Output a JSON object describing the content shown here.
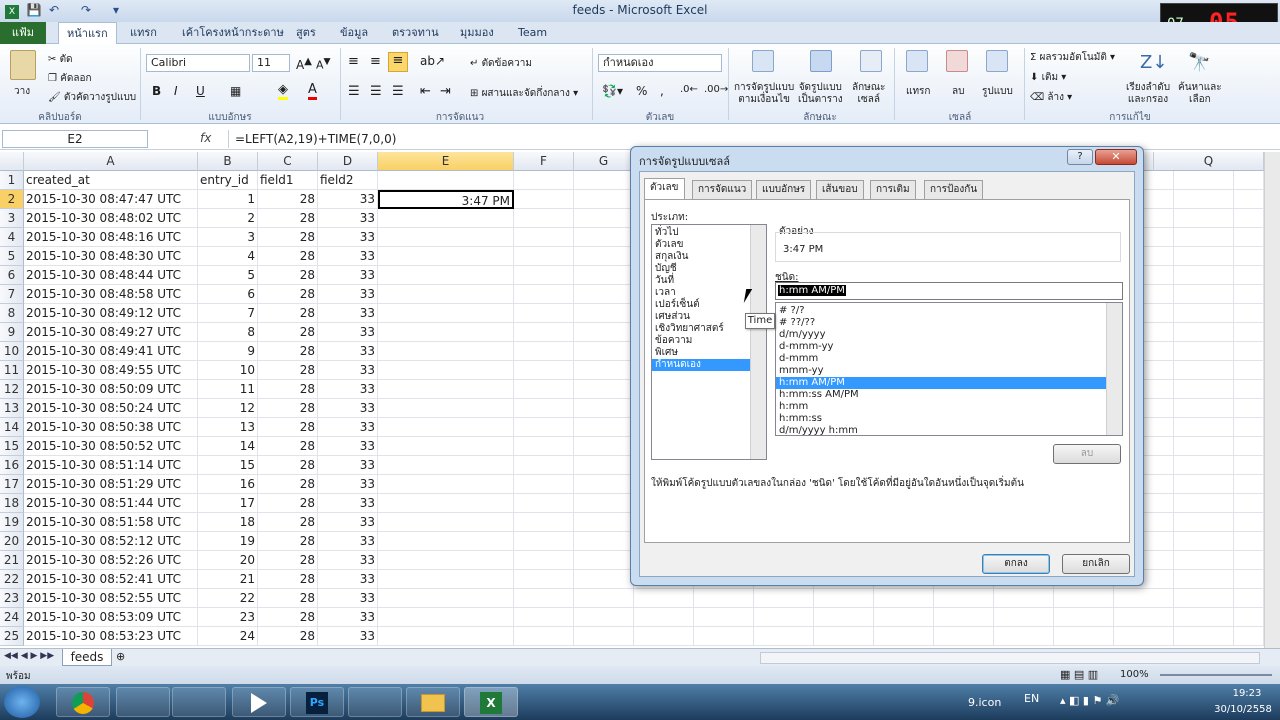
{
  "window": {
    "title": "feeds - Microsoft Excel"
  },
  "clock_overlay": {
    "small": "07",
    "big": "05"
  },
  "ribbon_tabs": [
    "แฟ้ม",
    "หน้าแรก",
    "แทรก",
    "เค้าโครงหน้ากระดาษ",
    "สูตร",
    "ข้อมูล",
    "ตรวจทาน",
    "มุมมอง",
    "Team"
  ],
  "ribbon": {
    "paste": "วาง",
    "cut": "ตัด",
    "copy": "คัดลอก",
    "format_painter": "ตัวคัดวางรูปแบบ",
    "clipboard": "คลิปบอร์ด",
    "font_name": "Calibri",
    "font_size": "11",
    "font_group": "แบบอักษร",
    "wrap": "ตัดข้อความ",
    "merge": "ผสานและจัดกึ่งกลาง",
    "alignment": "การจัดแนว",
    "number_format": "กำหนดเอง",
    "number": "ตัวเลข",
    "cond_format": "การจัดรูปแบบ\nตามเงื่อนไข",
    "format_table": "จัดรูปแบบ\nเป็นตาราง",
    "cell_styles": "ลักษณะ\nเซลล์",
    "styles": "ลักษณะ",
    "insert": "แทรก",
    "delete": "ลบ",
    "format": "รูปแบบ",
    "cells": "เซลล์",
    "autosum": "ผลรวมอัตโนมัติ",
    "fill": "เติม",
    "clear": "ล้าง",
    "sort": "เรียงลำดับ\nและกรอง",
    "find": "ค้นหาและ\nเลือก",
    "editing": "การแก้ไข"
  },
  "formula_bar": {
    "cell_ref": "E2",
    "fx": "fx",
    "formula": "=LEFT(A2,19)+TIME(7,0,0)"
  },
  "columns": [
    "A",
    "B",
    "C",
    "D",
    "E",
    "F",
    "G"
  ],
  "extra_columns": [
    "Q"
  ],
  "rows": [
    [
      "1",
      "created_at",
      "entry_id",
      "field1",
      "field2",
      ""
    ],
    [
      "2",
      "2015-10-30 08:47:47 UTC",
      "1",
      "28",
      "33",
      "3:47 PM"
    ],
    [
      "3",
      "2015-10-30 08:48:02 UTC",
      "2",
      "28",
      "33",
      ""
    ],
    [
      "4",
      "2015-10-30 08:48:16 UTC",
      "3",
      "28",
      "33",
      ""
    ],
    [
      "5",
      "2015-10-30 08:48:30 UTC",
      "4",
      "28",
      "33",
      ""
    ],
    [
      "6",
      "2015-10-30 08:48:44 UTC",
      "5",
      "28",
      "33",
      ""
    ],
    [
      "7",
      "2015-10-30 08:48:58 UTC",
      "6",
      "28",
      "33",
      ""
    ],
    [
      "8",
      "2015-10-30 08:49:12 UTC",
      "7",
      "28",
      "33",
      ""
    ],
    [
      "9",
      "2015-10-30 08:49:27 UTC",
      "8",
      "28",
      "33",
      ""
    ],
    [
      "10",
      "2015-10-30 08:49:41 UTC",
      "9",
      "28",
      "33",
      ""
    ],
    [
      "11",
      "2015-10-30 08:49:55 UTC",
      "10",
      "28",
      "33",
      ""
    ],
    [
      "12",
      "2015-10-30 08:50:09 UTC",
      "11",
      "28",
      "33",
      ""
    ],
    [
      "13",
      "2015-10-30 08:50:24 UTC",
      "12",
      "28",
      "33",
      ""
    ],
    [
      "14",
      "2015-10-30 08:50:38 UTC",
      "13",
      "28",
      "33",
      ""
    ],
    [
      "15",
      "2015-10-30 08:50:52 UTC",
      "14",
      "28",
      "33",
      ""
    ],
    [
      "16",
      "2015-10-30 08:51:14 UTC",
      "15",
      "28",
      "33",
      ""
    ],
    [
      "17",
      "2015-10-30 08:51:29 UTC",
      "16",
      "28",
      "33",
      ""
    ],
    [
      "18",
      "2015-10-30 08:51:44 UTC",
      "17",
      "28",
      "33",
      ""
    ],
    [
      "19",
      "2015-10-30 08:51:58 UTC",
      "18",
      "28",
      "33",
      ""
    ],
    [
      "20",
      "2015-10-30 08:52:12 UTC",
      "19",
      "28",
      "33",
      ""
    ],
    [
      "21",
      "2015-10-30 08:52:26 UTC",
      "20",
      "28",
      "33",
      ""
    ],
    [
      "22",
      "2015-10-30 08:52:41 UTC",
      "21",
      "28",
      "33",
      ""
    ],
    [
      "23",
      "2015-10-30 08:52:55 UTC",
      "22",
      "28",
      "33",
      ""
    ],
    [
      "24",
      "2015-10-30 08:53:09 UTC",
      "23",
      "28",
      "33",
      ""
    ],
    [
      "25",
      "2015-10-30 08:53:23 UTC",
      "24",
      "28",
      "33",
      ""
    ]
  ],
  "sheet_tab": "feeds",
  "status": {
    "ready": "พร้อม",
    "zoom": "100%"
  },
  "taskbar": {
    "lang": "EN",
    "file_label": "9.icon",
    "time": "19:23",
    "date": "30/10/2558"
  },
  "dialog": {
    "title": "การจัดรูปแบบเซลล์",
    "tabs": [
      "ตัวเลข",
      "การจัดแนว",
      "แบบอักษร",
      "เส้นขอบ",
      "การเติม",
      "การป้องกัน"
    ],
    "category_label": "ประเภท:",
    "categories": [
      "ทั่วไป",
      "ตัวเลข",
      "สกุลเงิน",
      "บัญชี",
      "วันที่",
      "เวลา",
      "เปอร์เซ็นต์",
      "เศษส่วน",
      "เชิงวิทยาศาสตร์",
      "ข้อความ",
      "พิเศษ",
      "กำหนดเอง"
    ],
    "sample_label": "ตัวอย่าง",
    "sample_value": "3:47 PM",
    "type_label": "ชนิด:",
    "type_value": "h:mm AM/PM",
    "types": [
      "# ?/?",
      "# ??/??",
      "d/m/yyyy",
      "d-mmm-yy",
      "d-mmm",
      "mmm-yy",
      "h:mm AM/PM",
      "h:mm:ss AM/PM",
      "h:mm",
      "h:mm:ss",
      "d/m/yyyy h:mm"
    ],
    "delete_btn": "ลบ",
    "description": "ให้พิมพ์โค้ดรูปแบบตัวเลขลงในกล่อง 'ชนิด' โดยใช้โค้ดที่มีอยู่อันใดอันหนึ่งเป็นจุดเริ่มต้น",
    "tooltip": "Time",
    "ok": "ตกลง",
    "cancel": "ยกเลิก"
  }
}
